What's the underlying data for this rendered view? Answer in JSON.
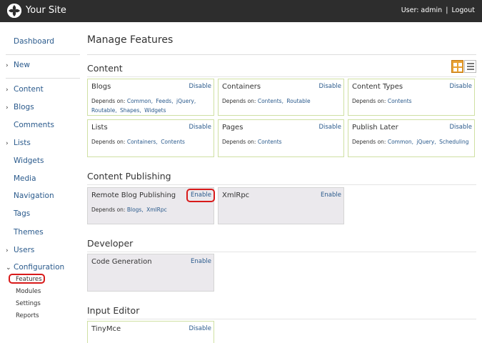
{
  "header": {
    "site_name": "Your Site",
    "user_label": "User: admin",
    "separator": "|",
    "logout": "Logout"
  },
  "sidebar": {
    "items": [
      {
        "label": "Dashboard",
        "chevron": false
      },
      {
        "label": "New",
        "chevron": true
      },
      {
        "label": "Content",
        "chevron": true
      },
      {
        "label": "Blogs",
        "chevron": true
      },
      {
        "label": "Comments",
        "chevron": false
      },
      {
        "label": "Lists",
        "chevron": true
      },
      {
        "label": "Widgets",
        "chevron": false
      },
      {
        "label": "Media",
        "chevron": false
      },
      {
        "label": "Navigation",
        "chevron": false
      },
      {
        "label": "Tags",
        "chevron": false
      },
      {
        "label": "Themes",
        "chevron": false
      },
      {
        "label": "Users",
        "chevron": true
      },
      {
        "label": "Configuration",
        "chevron": "open"
      }
    ],
    "sub_items": [
      "Features",
      "Modules",
      "Settings",
      "Reports"
    ]
  },
  "main": {
    "title": "Manage Features",
    "depends_label": "Depends on:",
    "sections": [
      {
        "title": "Content",
        "features": [
          {
            "name": "Blogs",
            "action": "Disable",
            "depends": [
              "Common,",
              "Feeds,",
              "jQuery,",
              "Routable,",
              "Shapes,",
              "Widgets"
            ]
          },
          {
            "name": "Containers",
            "action": "Disable",
            "depends": [
              "Contents,",
              "Routable"
            ]
          },
          {
            "name": "Content Types",
            "action": "Disable",
            "depends": [
              "Contents"
            ]
          },
          {
            "name": "Lists",
            "action": "Disable",
            "depends": [
              "Containers,",
              "Contents"
            ]
          },
          {
            "name": "Pages",
            "action": "Disable",
            "depends": [
              "Contents"
            ]
          },
          {
            "name": "Publish Later",
            "action": "Disable",
            "depends": [
              "Common,",
              "jQuery,",
              "Scheduling"
            ]
          }
        ]
      },
      {
        "title": "Content Publishing",
        "features": [
          {
            "name": "Remote Blog Publishing",
            "action": "Enable",
            "depends": [
              "Blogs,",
              "XmlRpc"
            ]
          },
          {
            "name": "XmlRpc",
            "action": "Enable",
            "depends": []
          }
        ]
      },
      {
        "title": "Developer",
        "features": [
          {
            "name": "Code Generation",
            "action": "Enable",
            "depends": []
          }
        ]
      },
      {
        "title": "Input Editor",
        "features": [
          {
            "name": "TinyMce",
            "action": "Disable",
            "depends": []
          }
        ]
      }
    ]
  },
  "colors": {
    "topbar": "#2d2d2d",
    "link": "#2a5a8c",
    "enabled_border": "#cfe0a3",
    "disabled_bg": "#ebe9ed",
    "highlight": "#d81a1a",
    "toggle_active": "#e8a132"
  }
}
